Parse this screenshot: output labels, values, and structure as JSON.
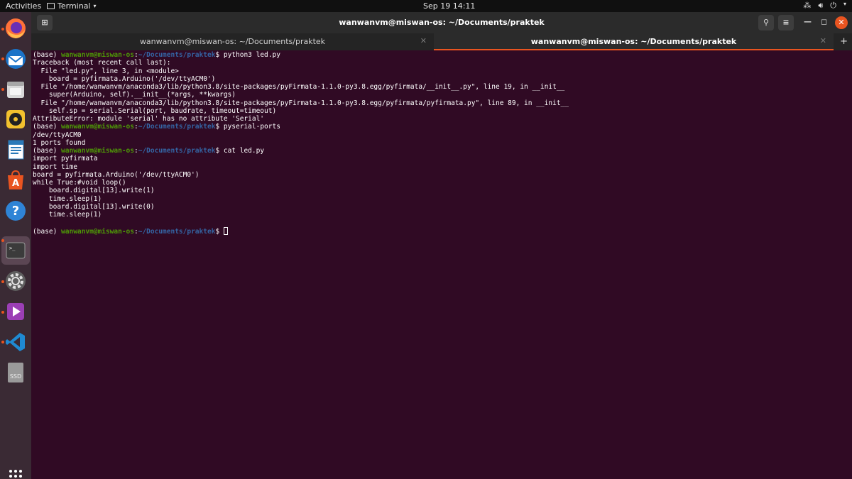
{
  "topbar": {
    "activities": "Activities",
    "app_menu": "Terminal",
    "clock": "Sep 19  14:11"
  },
  "dock": {
    "items": [
      {
        "name": "Firefox",
        "icon": "firefox-icon"
      },
      {
        "name": "Thunderbird",
        "icon": "mail-icon"
      },
      {
        "name": "Files",
        "icon": "files-icon"
      },
      {
        "name": "Rhythmbox",
        "icon": "rhythmbox-icon"
      },
      {
        "name": "LibreOffice Writer",
        "icon": "writer-icon"
      },
      {
        "name": "Ubuntu Software",
        "icon": "software-icon"
      },
      {
        "name": "Help",
        "icon": "help-icon"
      },
      {
        "name": "Terminal",
        "icon": "terminal-icon"
      },
      {
        "name": "Settings",
        "icon": "settings-icon"
      },
      {
        "name": "Videos",
        "icon": "video-icon"
      },
      {
        "name": "Visual Studio Code",
        "icon": "vscode-icon"
      },
      {
        "name": "SSD",
        "icon": "drive-icon",
        "label": "SSD"
      },
      {
        "name": "Show Applications",
        "icon": "grid-icon"
      }
    ]
  },
  "window": {
    "title": "wanwanvm@miswan-os: ~/Documents/praktek",
    "tabs": [
      {
        "label": "wanwanvm@miswan-os: ~/Documents/praktek",
        "active": false
      },
      {
        "label": "wanwanvm@miswan-os: ~/Documents/praktek",
        "active": true
      }
    ]
  },
  "terminal": {
    "prompt_base": "(base) ",
    "prompt_user": "wanwanvm@miswan-os",
    "prompt_sep": ":",
    "prompt_path": "~/Documents/praktek",
    "prompt_end": "$ ",
    "lines": [
      {
        "type": "prompt",
        "cmd": "python3 led.py"
      },
      {
        "type": "out",
        "text": "Traceback (most recent call last):"
      },
      {
        "type": "out",
        "text": "  File \"led.py\", line 3, in <module>"
      },
      {
        "type": "out",
        "text": "    board = pyfirmata.Arduino('/dev/ttyACM0')"
      },
      {
        "type": "out",
        "text": "  File \"/home/wanwanvm/anaconda3/lib/python3.8/site-packages/pyFirmata-1.1.0-py3.8.egg/pyfirmata/__init__.py\", line 19, in __init__"
      },
      {
        "type": "out",
        "text": "    super(Arduino, self).__init__(*args, **kwargs)"
      },
      {
        "type": "out",
        "text": "  File \"/home/wanwanvm/anaconda3/lib/python3.8/site-packages/pyFirmata-1.1.0-py3.8.egg/pyfirmata/pyfirmata.py\", line 89, in __init__"
      },
      {
        "type": "out",
        "text": "    self.sp = serial.Serial(port, baudrate, timeout=timeout)"
      },
      {
        "type": "out",
        "text": "AttributeError: module 'serial' has no attribute 'Serial'"
      },
      {
        "type": "prompt",
        "cmd": "pyserial-ports"
      },
      {
        "type": "out",
        "text": "/dev/ttyACM0"
      },
      {
        "type": "out",
        "text": "1 ports found"
      },
      {
        "type": "prompt",
        "cmd": "cat led.py"
      },
      {
        "type": "out",
        "text": "import pyfirmata"
      },
      {
        "type": "out",
        "text": "import time"
      },
      {
        "type": "out",
        "text": "board = pyfirmata.Arduino('/dev/ttyACM0')"
      },
      {
        "type": "out",
        "text": "while True:#void loop()"
      },
      {
        "type": "out",
        "text": "    board.digital[13].write(1)"
      },
      {
        "type": "out",
        "text": "    time.sleep(1)"
      },
      {
        "type": "out",
        "text": "    board.digital[13].write(0)"
      },
      {
        "type": "out",
        "text": "    time.sleep(1)"
      },
      {
        "type": "out",
        "text": ""
      },
      {
        "type": "prompt",
        "cmd": "",
        "cursor": true
      }
    ]
  },
  "colors": {
    "terminal_bg": "#300a24",
    "accent": "#e95420",
    "prompt_user": "#4e9a06",
    "prompt_path": "#3465a4"
  }
}
